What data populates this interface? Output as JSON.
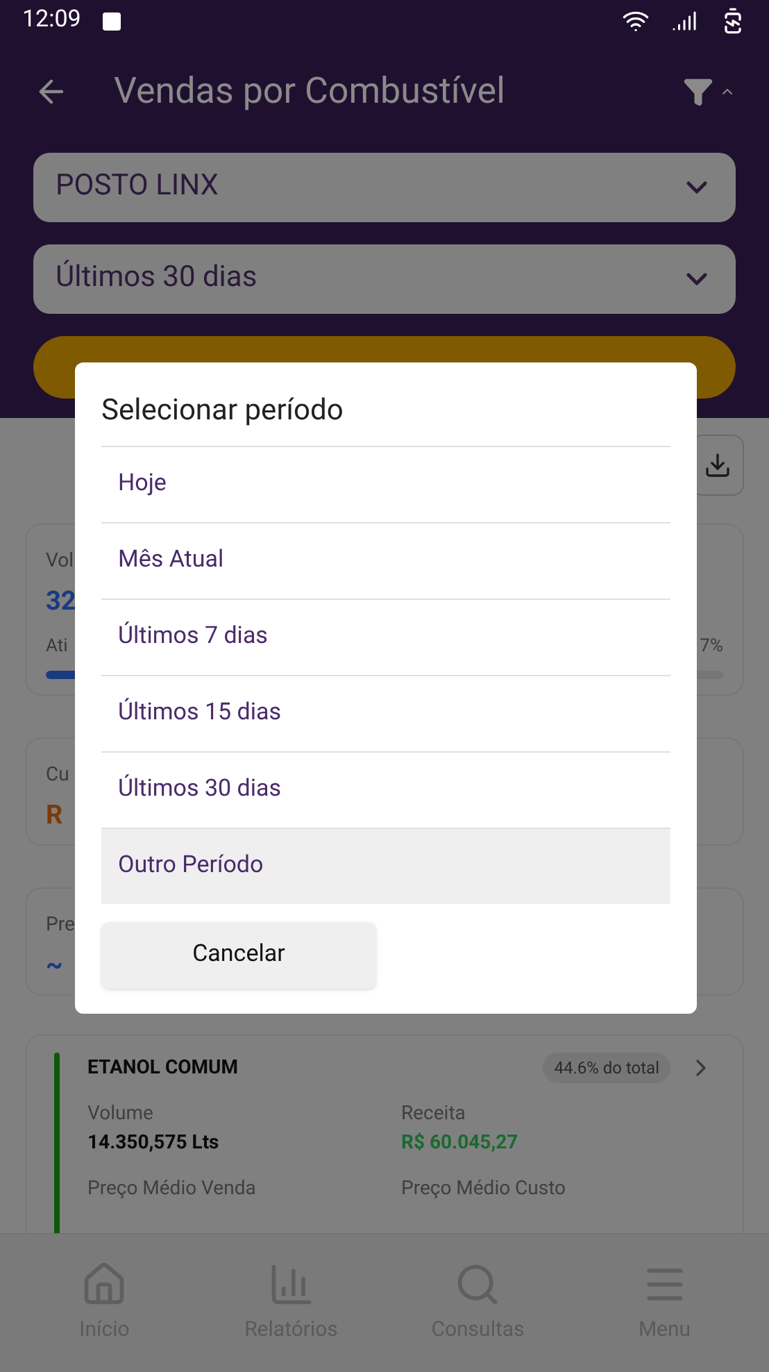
{
  "status_bar": {
    "time": "12:09"
  },
  "header": {
    "title": "Vendas por Combustível"
  },
  "filters": [
    {
      "value": "POSTO LINX"
    },
    {
      "value": "Últimos 30 dias"
    }
  ],
  "summary_cards": [
    {
      "label": "Vol",
      "value": "32",
      "kind": "progress",
      "caption": "Ati",
      "reading": "7%",
      "level": 0.5,
      "color": "#1a3a80"
    },
    {
      "label": "Cu",
      "value": "R",
      "kind": "plain",
      "color": "#7a3a0a"
    },
    {
      "label": "Pre",
      "value": "~",
      "kind": "plain",
      "color": "#1a3a80"
    }
  ],
  "fuel_card": {
    "name": "ETANOL COMUM",
    "share": "44.6% do total",
    "fields": [
      {
        "label": "Volume",
        "value": "14.350,575 Lts",
        "kind": "plain"
      },
      {
        "label": "Receita",
        "value": "R$ 60.045,27",
        "kind": "money"
      },
      {
        "label": "Preço Médio Venda"
      },
      {
        "label": "Preço Médio Custo"
      }
    ]
  },
  "dialog": {
    "title": "Selecionar período",
    "options": [
      {
        "label": "Hoje",
        "selected": false
      },
      {
        "label": "Mês Atual",
        "selected": false
      },
      {
        "label": "Últimos 7 dias",
        "selected": false
      },
      {
        "label": "Últimos 15 dias",
        "selected": false
      },
      {
        "label": "Últimos 30 dias",
        "selected": false
      },
      {
        "label": "Outro Período",
        "selected": true
      }
    ],
    "cancel": "Cancelar"
  },
  "bottom_nav": [
    {
      "label": "Início"
    },
    {
      "label": "Relatórios"
    },
    {
      "label": "Consultas"
    },
    {
      "label": "Menu"
    }
  ]
}
